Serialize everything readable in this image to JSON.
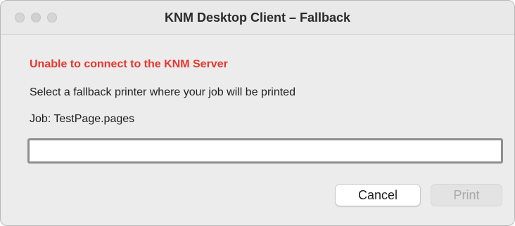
{
  "window": {
    "title": "KNM Desktop Client – Fallback"
  },
  "dialog": {
    "error_message": "Unable to connect to the KNM Server",
    "prompt": "Select a fallback printer where your job will be printed",
    "job_label": "Job: TestPage.pages",
    "printer_field_value": ""
  },
  "buttons": {
    "cancel_label": "Cancel",
    "print_label": "Print",
    "print_enabled": false
  },
  "colors": {
    "error": "#e6372f",
    "window_bg": "#ececec",
    "disabled_text": "#a9a9a9"
  }
}
